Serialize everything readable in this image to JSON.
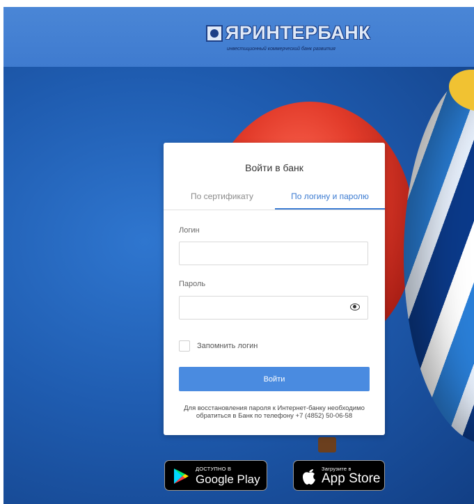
{
  "header": {
    "logo_title": "ЯРИНТЕРБАНК",
    "logo_subtitle": "инвестиционный коммерческий банк развития"
  },
  "login_card": {
    "title": "Войти в банк",
    "tabs": [
      {
        "label": "По сертификату",
        "active": false
      },
      {
        "label": "По логину и паролю",
        "active": true
      }
    ],
    "login_label": "Логин",
    "login_value": "",
    "password_label": "Пароль",
    "password_value": "",
    "remember_label": "Запомнить логин",
    "remember_checked": false,
    "submit_label": "Войти",
    "recovery_note": "Для восстановления пароля к Интернет-банку необходимо обратиться в Банк по телефону +7 (4852) 50-06-58"
  },
  "stores": {
    "google_play": {
      "small": "ДОСТУПНО В",
      "big": "Google Play"
    },
    "app_store": {
      "small": "Загрузите в",
      "big": "App Store"
    }
  },
  "colors": {
    "header": "#4a86d6",
    "accent": "#3a7ad1",
    "button": "#4a8be0"
  }
}
